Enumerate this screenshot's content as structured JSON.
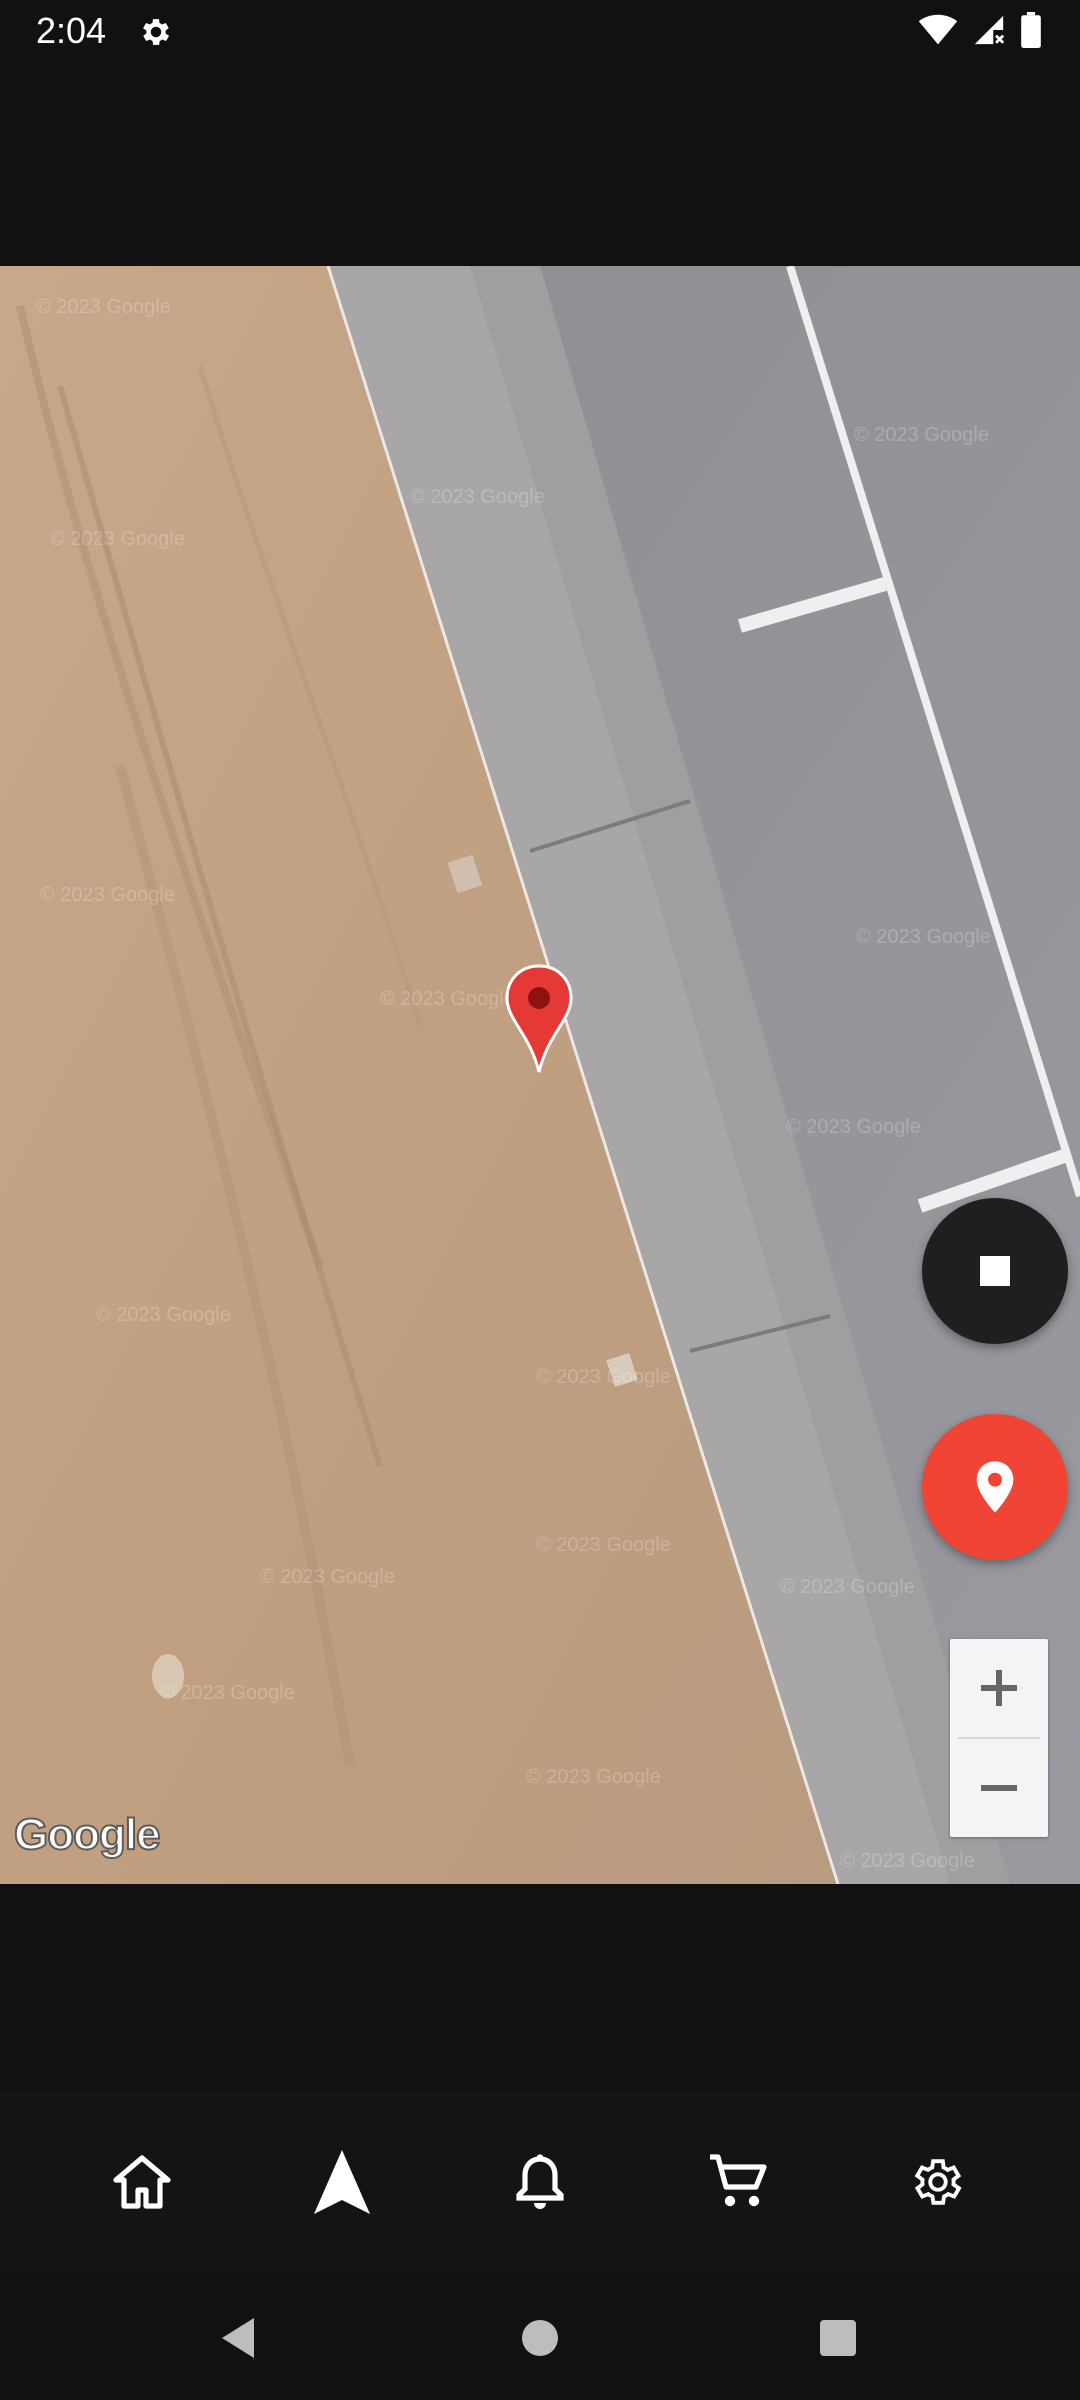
{
  "status_bar": {
    "time": "2:04",
    "icons": [
      "settings-icon",
      "wifi-icon",
      "cellular-no-data-icon",
      "battery-icon"
    ]
  },
  "map": {
    "provider_logo": "Google",
    "watermarks": [
      "© 2023 Google",
      "© 2023 Google",
      "© 2023 Google",
      "© 2023 Google",
      "© 2023 Google",
      "© 2023 Google",
      "© 2023 Google",
      "© 2023 Google",
      "© 2023 Google",
      "© 2023 Google",
      "© 2023 Google",
      "© 2023 Google",
      "© 2023 Google",
      "© 2023 Google",
      "© 2023 Google",
      "© 2023 Google"
    ],
    "marker_icon": "map-pin-icon",
    "zoom_in_label": "+",
    "zoom_out_label": "−"
  },
  "fabs": {
    "stop_icon": "stop-icon",
    "location_icon": "location-pin-icon"
  },
  "bottom_nav": {
    "items": [
      "home-icon",
      "navigation-arrow-icon",
      "bell-icon",
      "cart-icon",
      "settings-icon"
    ]
  },
  "system_nav": {
    "items": [
      "back-icon",
      "home-circle-icon",
      "recents-icon"
    ]
  },
  "colors": {
    "accent": "#f04434",
    "pin": "#e53935",
    "fab_dark": "#1f1f1f",
    "background": "#111112"
  }
}
